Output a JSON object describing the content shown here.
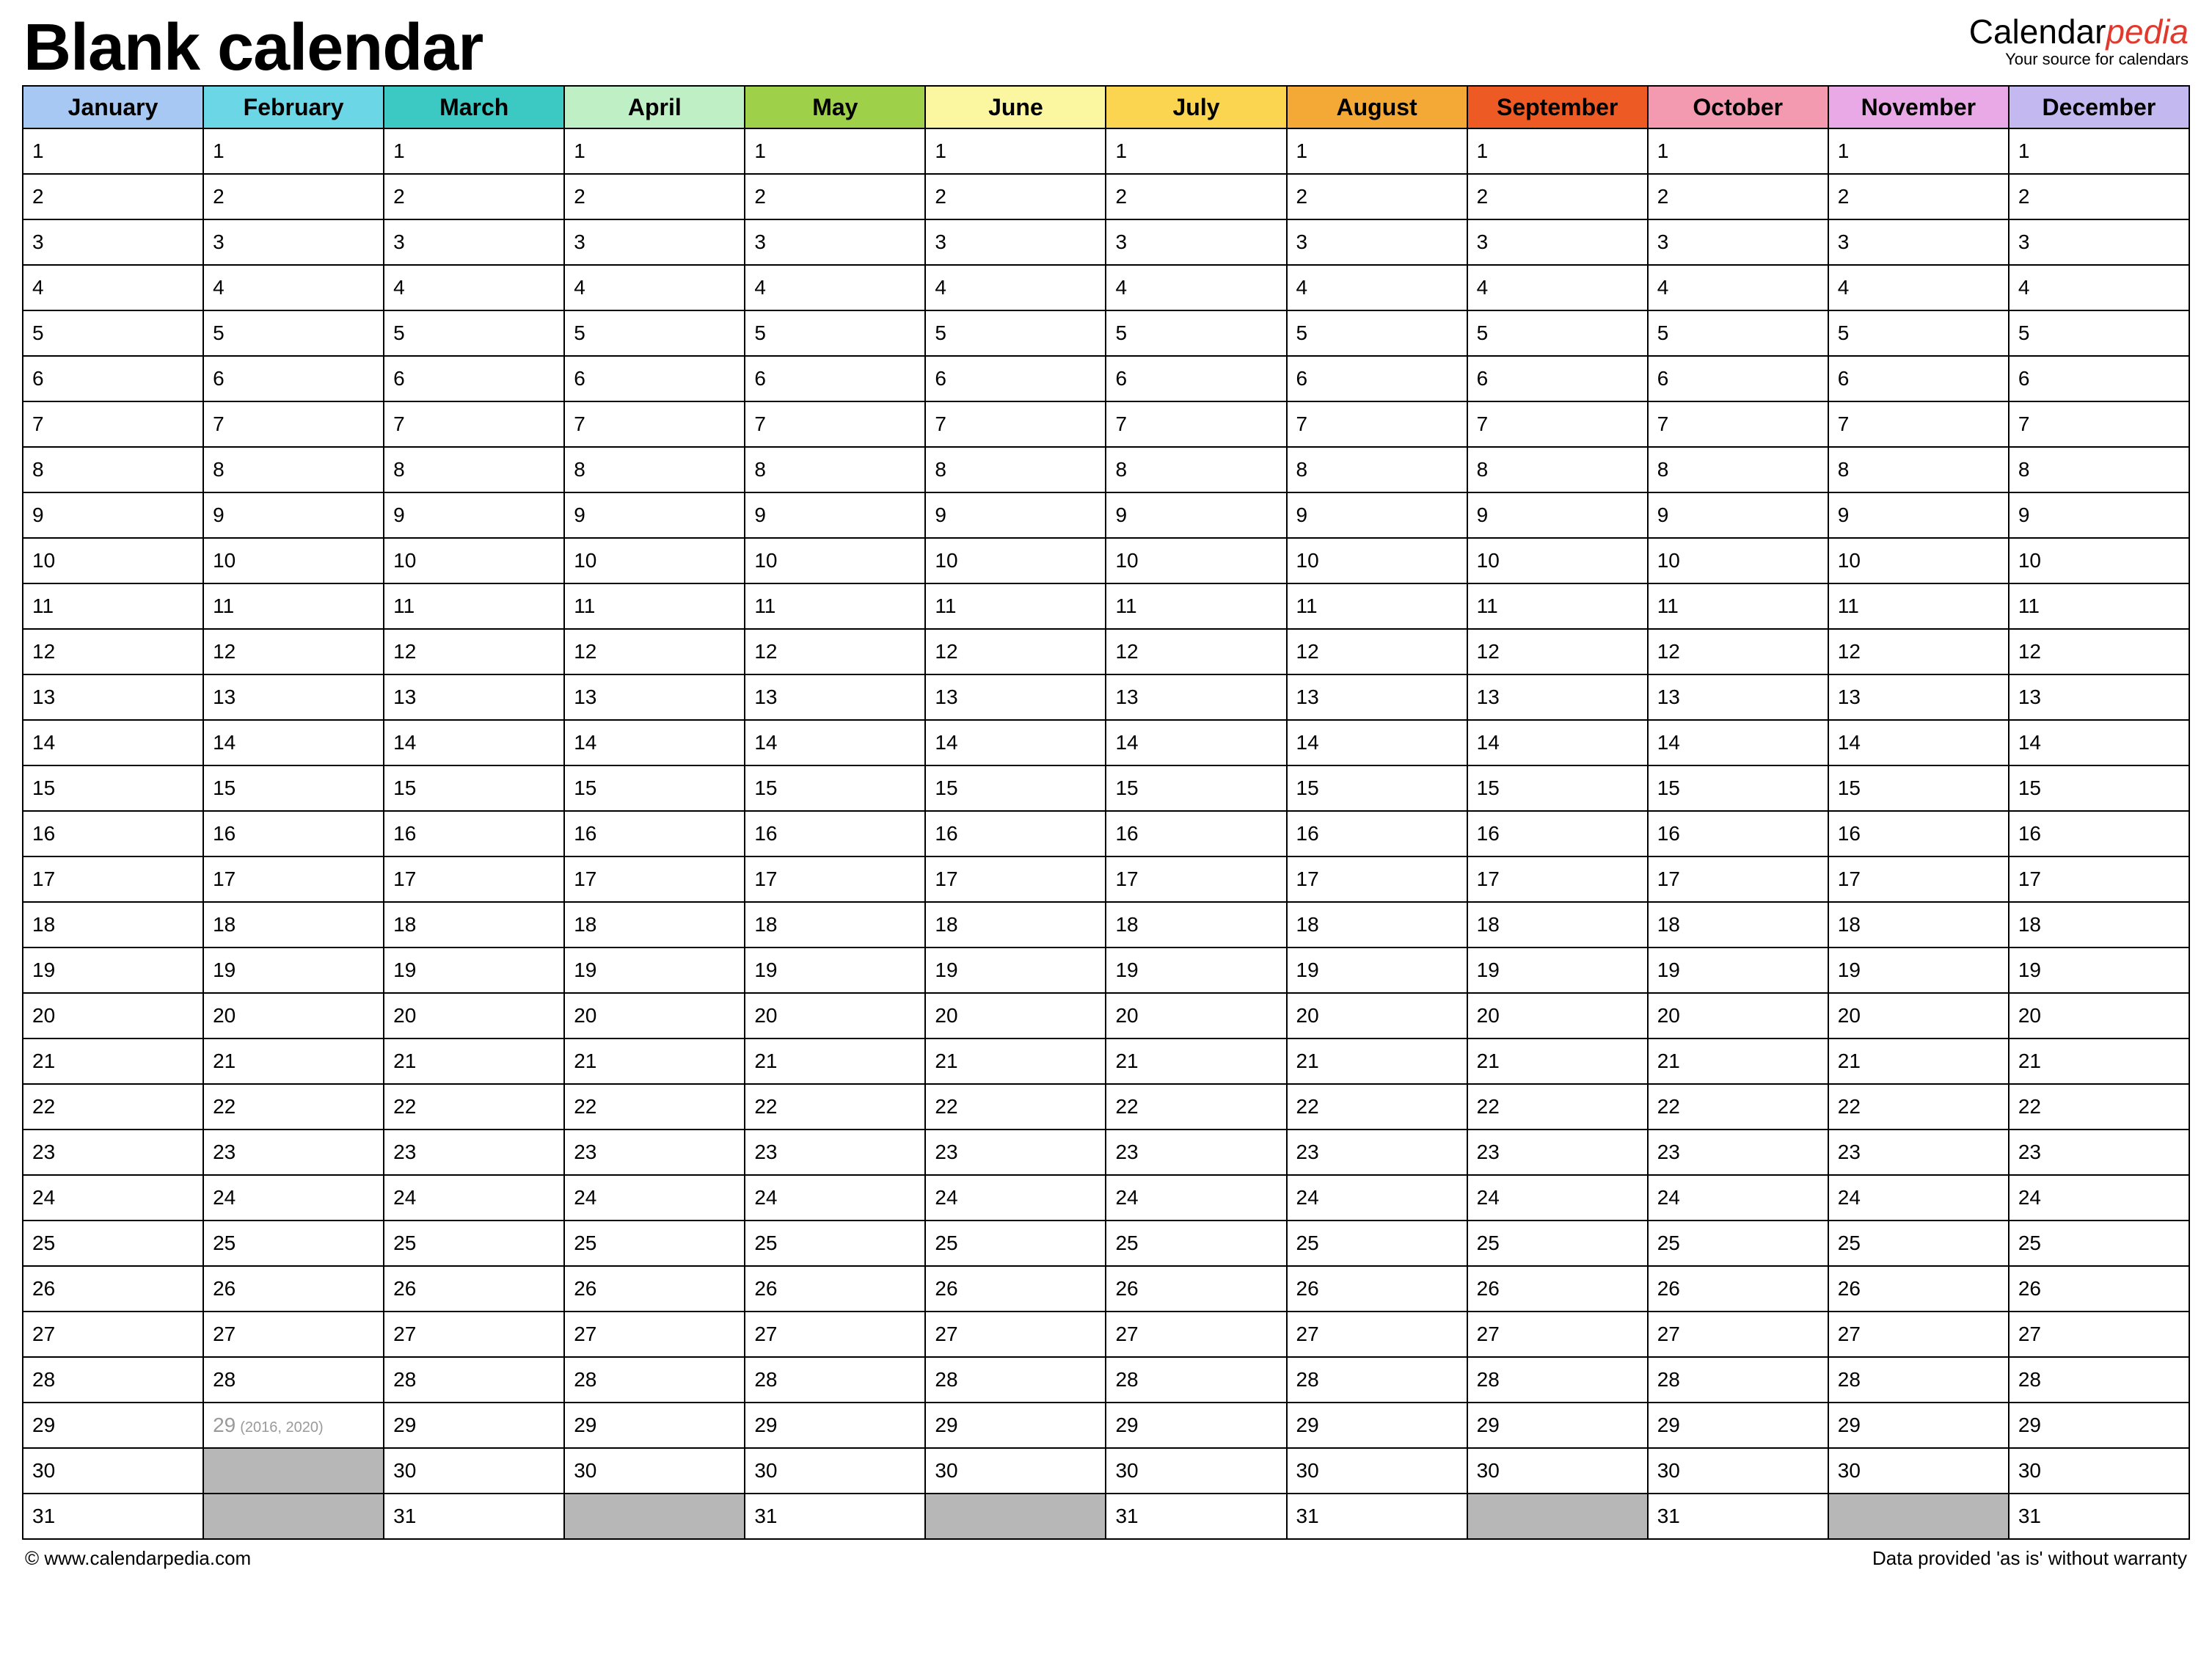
{
  "header": {
    "title": "Blank calendar",
    "logo_part1": "Calendar",
    "logo_part2": "pedia",
    "logo_tagline": "Your source for calendars"
  },
  "months": [
    {
      "name": "January",
      "color": "#a7c8f2",
      "days": 31
    },
    {
      "name": "February",
      "color": "#6bd7e6",
      "days": 28,
      "leap_day": 29,
      "leap_note": "(2016, 2020)"
    },
    {
      "name": "March",
      "color": "#3cc9c3",
      "days": 31
    },
    {
      "name": "April",
      "color": "#bff0c5",
      "days": 30
    },
    {
      "name": "May",
      "color": "#9ed04a",
      "days": 31
    },
    {
      "name": "June",
      "color": "#fbf7a0",
      "days": 30
    },
    {
      "name": "July",
      "color": "#fbd54f",
      "days": 31
    },
    {
      "name": "August",
      "color": "#f4a835",
      "days": 31
    },
    {
      "name": "September",
      "color": "#ee5a24",
      "days": 30
    },
    {
      "name": "October",
      "color": "#f49ab0",
      "days": 31
    },
    {
      "name": "November",
      "color": "#e8a9e6",
      "days": 30
    },
    {
      "name": "December",
      "color": "#c4b8f0",
      "days": 31
    }
  ],
  "max_rows": 31,
  "footer": {
    "left": "© www.calendarpedia.com",
    "right": "Data provided 'as is' without warranty"
  }
}
